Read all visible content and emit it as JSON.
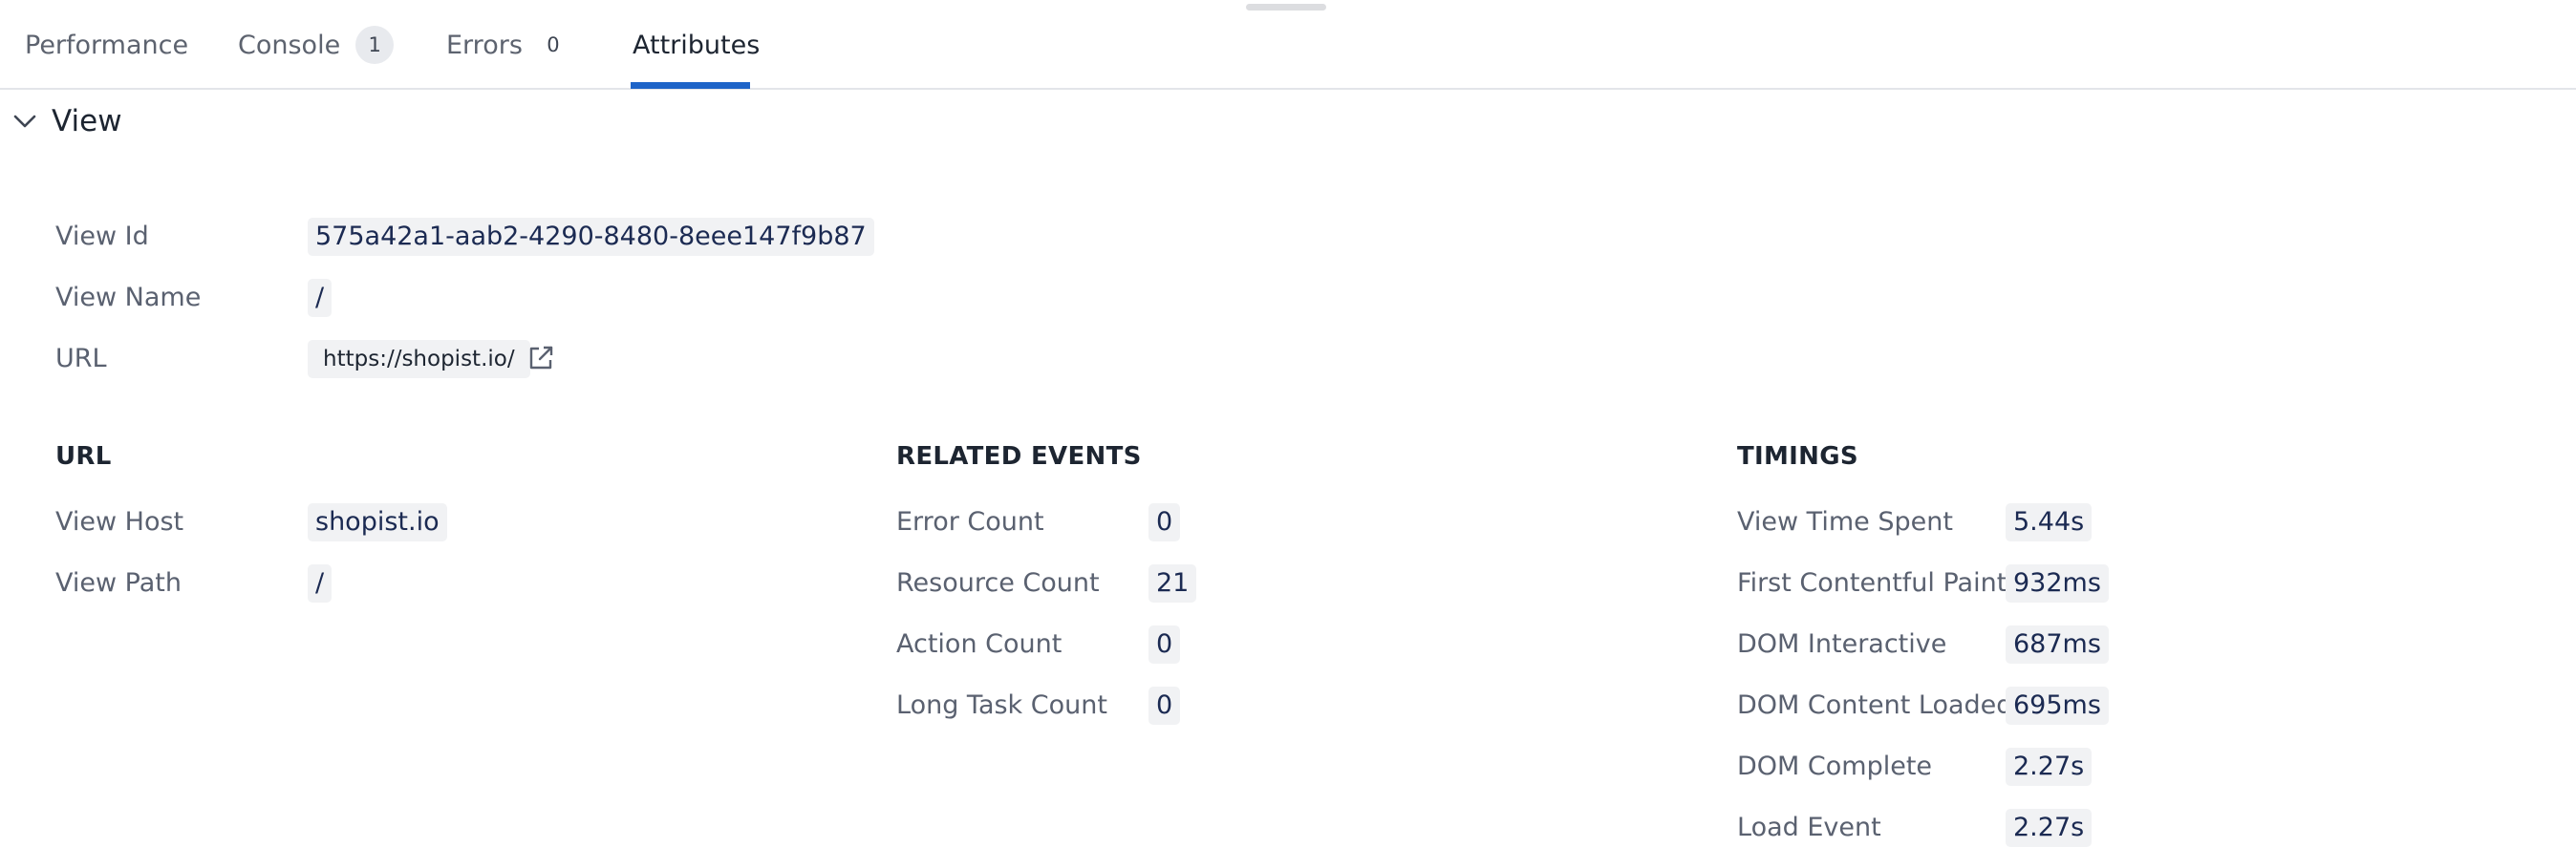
{
  "tabs": [
    {
      "label": "Performance"
    },
    {
      "label": "Console",
      "count": "1"
    },
    {
      "label": "Errors",
      "count": "0"
    },
    {
      "label": "Attributes"
    }
  ],
  "section": {
    "title": "View",
    "icon": "chevron-down-icon"
  },
  "view": {
    "view_id": {
      "label": "View Id",
      "value": "575a42a1-aab2-4290-8480-8eee147f9b87"
    },
    "view_name": {
      "label": "View Name",
      "value": "/"
    },
    "url": {
      "label": "URL",
      "value": "https://shopist.io/",
      "icon": "external-link-icon"
    }
  },
  "url_group": {
    "heading": "URL",
    "host": {
      "label": "View Host",
      "value": "shopist.io"
    },
    "path": {
      "label": "View Path",
      "value": "/"
    }
  },
  "related_events": {
    "heading": "RELATED EVENTS",
    "error_count": {
      "label": "Error Count",
      "value": "0"
    },
    "resource_count": {
      "label": "Resource Count",
      "value": "21"
    },
    "action_count": {
      "label": "Action Count",
      "value": "0"
    },
    "long_task_count": {
      "label": "Long Task Count",
      "value": "0"
    }
  },
  "timings": {
    "heading": "TIMINGS",
    "time_spent": {
      "label": "View Time Spent",
      "value": "5.44s"
    },
    "fcp": {
      "label": "First Contentful Paint",
      "value": "932ms"
    },
    "dom_interactive": {
      "label": "DOM Interactive",
      "value": "687ms"
    },
    "dom_content_loaded": {
      "label": "DOM Content Loaded",
      "value": "695ms"
    },
    "dom_complete": {
      "label": "DOM Complete",
      "value": "2.27s"
    },
    "load_event": {
      "label": "Load Event",
      "value": "2.27s"
    }
  },
  "colors": {
    "accent": "#1e64c8",
    "chip_background": "#f1f2f4",
    "value_text": "#1b2a52"
  }
}
